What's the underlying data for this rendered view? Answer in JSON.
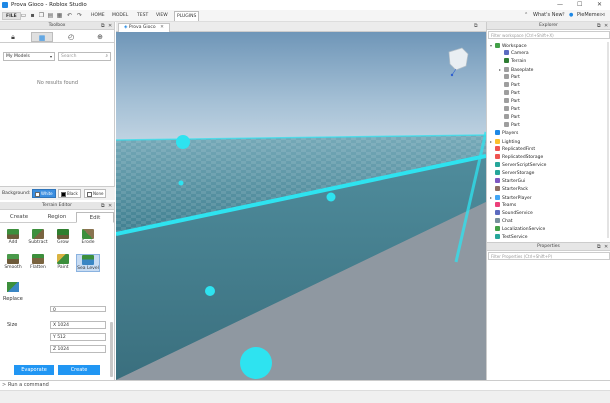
{
  "window": {
    "title": "Prova Gioco - Roblox Studio",
    "minimize_glyph": "—",
    "maximize_glyph": "☐",
    "close_glyph": "✕"
  },
  "menubar": {
    "file_label": "FILE",
    "items": [
      "HOME",
      "MODEL",
      "TEST",
      "VIEW",
      "PLUGINS"
    ],
    "active_item": "PLUGINS",
    "whats_new": "What's New",
    "user_name": "PieMeme"
  },
  "toolbox": {
    "title": "Toolbox",
    "category": "My Models",
    "search_placeholder": "Search",
    "no_results": "No results found",
    "background_label": "Background:",
    "bg_options": [
      "White",
      "Black",
      "None"
    ],
    "bg_selected": "White"
  },
  "terrain": {
    "title": "Terrain Editor",
    "tabs": [
      "Create",
      "Region",
      "Edit"
    ],
    "active_tab": "Edit",
    "tools": [
      "Add",
      "Subtract",
      "Grow",
      "Erode",
      "Smooth",
      "Flatten",
      "Paint",
      "Sea Level",
      "Replace"
    ],
    "selected_tool": "Sea Level",
    "size_label": "Size",
    "axes": [
      "X",
      "Y",
      "Z"
    ],
    "partial_value": "0",
    "size_values": [
      "1024",
      "512",
      "1024"
    ],
    "evaporate_label": "Evaporate",
    "create_label": "Create"
  },
  "viewport": {
    "tab_label": "Prova Gioco"
  },
  "explorer": {
    "title": "Explorer",
    "filter_placeholder": "Filter workspace (Ctrl+Shift+X)",
    "items": [
      {
        "label": "Workspace",
        "depth": 0,
        "caret": "▾",
        "color": "#43a047"
      },
      {
        "label": "Camera",
        "depth": 1,
        "caret": "",
        "color": "#5c6bc0"
      },
      {
        "label": "Terrain",
        "depth": 1,
        "caret": "",
        "color": "#2e7d32"
      },
      {
        "label": "Baseplate",
        "depth": 1,
        "caret": "▸",
        "color": "#9e9e9e"
      },
      {
        "label": "Part",
        "depth": 1,
        "caret": "",
        "color": "#9e9e9e"
      },
      {
        "label": "Part",
        "depth": 1,
        "caret": "",
        "color": "#9e9e9e"
      },
      {
        "label": "Part",
        "depth": 1,
        "caret": "",
        "color": "#9e9e9e"
      },
      {
        "label": "Part",
        "depth": 1,
        "caret": "",
        "color": "#9e9e9e"
      },
      {
        "label": "Part",
        "depth": 1,
        "caret": "",
        "color": "#9e9e9e"
      },
      {
        "label": "Part",
        "depth": 1,
        "caret": "",
        "color": "#9e9e9e"
      },
      {
        "label": "Part",
        "depth": 1,
        "caret": "",
        "color": "#9e9e9e"
      },
      {
        "label": "Players",
        "depth": 0,
        "caret": "",
        "color": "#1e88e5"
      },
      {
        "label": "Lighting",
        "depth": 0,
        "caret": "▸",
        "color": "#fbc02d"
      },
      {
        "label": "ReplicatedFirst",
        "depth": 0,
        "caret": "",
        "color": "#ef5350"
      },
      {
        "label": "ReplicatedStorage",
        "depth": 0,
        "caret": "",
        "color": "#ef5350"
      },
      {
        "label": "ServerScriptService",
        "depth": 0,
        "caret": "",
        "color": "#26a69a"
      },
      {
        "label": "ServerStorage",
        "depth": 0,
        "caret": "",
        "color": "#26a69a"
      },
      {
        "label": "StarterGui",
        "depth": 0,
        "caret": "",
        "color": "#7e57c2"
      },
      {
        "label": "StarterPack",
        "depth": 0,
        "caret": "",
        "color": "#8d6e63"
      },
      {
        "label": "StarterPlayer",
        "depth": 0,
        "caret": "▸",
        "color": "#42a5f5"
      },
      {
        "label": "Teams",
        "depth": 0,
        "caret": "",
        "color": "#ec407a"
      },
      {
        "label": "SoundService",
        "depth": 0,
        "caret": "",
        "color": "#5c6bc0"
      },
      {
        "label": "Chat",
        "depth": 0,
        "caret": "",
        "color": "#78909c"
      },
      {
        "label": "LocalizationService",
        "depth": 0,
        "caret": "",
        "color": "#43a047"
      },
      {
        "label": "TestService",
        "depth": 0,
        "caret": "",
        "color": "#26a69a"
      }
    ]
  },
  "properties": {
    "title": "Properties",
    "filter_placeholder": "Filter Properties (Ctrl+Shift+P)"
  },
  "command": {
    "prompt": ">",
    "placeholder": "Run a command"
  },
  "colors": {
    "accent": "#2196f3",
    "neon": "#2ee3f0",
    "water": "#4f8c9c"
  }
}
